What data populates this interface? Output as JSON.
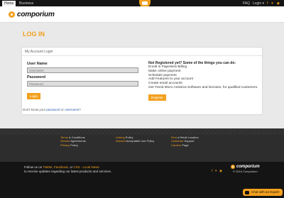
{
  "topnav": {
    "tabs": [
      {
        "label": "Home"
      },
      {
        "label": "Business"
      }
    ],
    "faq": "FAQ",
    "login": "Login ▾",
    "social_icons": [
      "facebook-icon",
      "twitter-icon",
      "instagram-icon"
    ]
  },
  "header": {
    "logo_text": "comporium"
  },
  "page": {
    "title": "LOG IN"
  },
  "login_panel": {
    "header": "My Account Login",
    "username_label": "User Name",
    "username_placeholder": "Username",
    "password_label": "Password",
    "password_placeholder": "Password",
    "login_button": "Login",
    "register_title": "Not Registered yet? Some of the things you can do:",
    "register_items": [
      "Enroll in Paperless Billing",
      "Make online payment",
      "Schedule payment",
      "Add Features to your account",
      "Create email accounts",
      "Get Trend Micro Antivirus Software and licenses, for qualified customers."
    ],
    "register_button": "Register",
    "forgot_prefix": "Don't know your",
    "forgot_password": "password",
    "forgot_or": "or",
    "forgot_username": "username",
    "forgot_suffix": "?"
  },
  "footer": {
    "col1": [
      {
        "hl": "Terms",
        "rest": " & Conditions"
      },
      {
        "hl": "Service",
        "rest": " Agreements"
      },
      {
        "hl": "Privacy",
        "rest": " Policy"
      }
    ],
    "col2": [
      {
        "hl": "Linking",
        "rest": " Policy"
      },
      {
        "hl": "Internet",
        "rest": " Acceptable Use Policy"
      }
    ],
    "col3": [
      {
        "hl": "Find",
        "rest": " a Retail Location"
      },
      {
        "hl": "Customer",
        "rest": " Support"
      },
      {
        "hl": "Careers",
        "rest": " Page"
      }
    ],
    "follow": {
      "prefix": "Follow us on",
      "twitter": "Twitter",
      "sep1": ",",
      "facebook": "Facebook",
      "sep2": ", or",
      "ch2": "CH2 - Local News",
      "line2": "to receive updates regarding our latest products and services."
    },
    "logo_text": "comporium",
    "copyright": "© 2016 Comporium"
  },
  "chat": {
    "label": "Chat with an Expert"
  },
  "colors": {
    "accent": "#f2a01f",
    "topbar": "#141414",
    "footer": "#2d2d2d"
  }
}
